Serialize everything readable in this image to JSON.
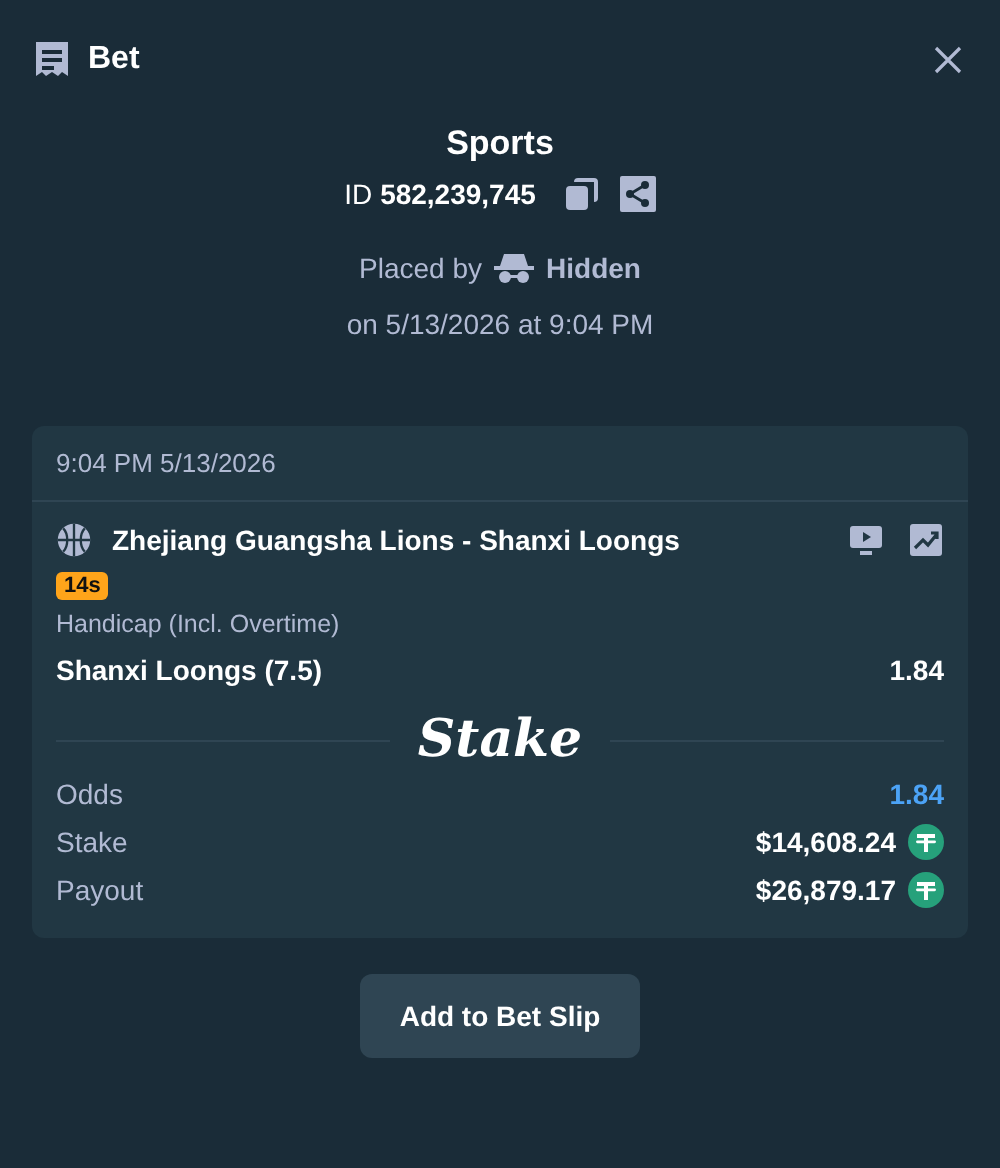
{
  "header": {
    "title": "Bet"
  },
  "bet": {
    "category": "Sports",
    "id_label": "ID",
    "id_value": "582,239,745",
    "placed_by_label": "Placed by",
    "placed_by_user": "Hidden",
    "placed_on": "on 5/13/2026 at 9:04 PM"
  },
  "card": {
    "timestamp": "9:04 PM 5/13/2026",
    "event": "Zhejiang Guangsha Lions - Shanxi Loongs",
    "live_badge": "14s",
    "market": "Handicap (Incl. Overtime)",
    "selection": "Shanxi Loongs (7.5)",
    "selection_odds": "1.84",
    "logo": "Stake",
    "summary": [
      {
        "kind": "odds",
        "label": "Odds",
        "value": "1.84"
      },
      {
        "kind": "amount",
        "label": "Stake",
        "value": "$14,608.24"
      },
      {
        "kind": "amount",
        "label": "Payout",
        "value": "$26,879.17"
      }
    ]
  },
  "buttons": [
    "Add to Bet Slip"
  ]
}
